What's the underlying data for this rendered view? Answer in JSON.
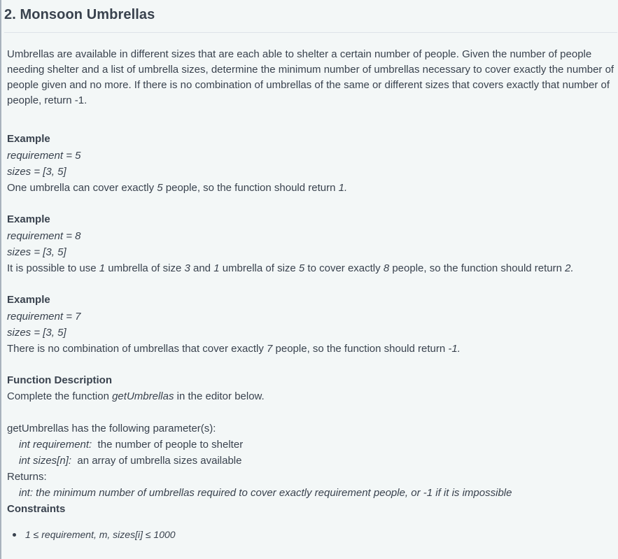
{
  "problem": {
    "title": "2. Monsoon Umbrellas",
    "intro": "Umbrellas are available in different sizes that are each able to shelter a certain number of people. Given the number of people needing shelter and a list of umbrella sizes, determine the minimum number of umbrellas necessary to cover exactly the number of people given and no more. If there is no combination of umbrellas of the same or different sizes that covers exactly that number of people, return -1."
  },
  "examples": [
    {
      "heading": "Example",
      "requirement": "requirement = 5",
      "sizes": "sizes = [3, 5]",
      "explanation": [
        {
          "t": "One umbrella can cover exactly ",
          "i": false
        },
        {
          "t": "5",
          "i": true
        },
        {
          "t": " people, so the function should return ",
          "i": false
        },
        {
          "t": "1.",
          "i": true
        }
      ]
    },
    {
      "heading": "Example",
      "requirement": "requirement = 8",
      "sizes": "sizes = [3, 5]",
      "explanation": [
        {
          "t": "It is possible to use ",
          "i": false
        },
        {
          "t": "1",
          "i": true
        },
        {
          "t": " umbrella of size ",
          "i": false
        },
        {
          "t": "3",
          "i": true
        },
        {
          "t": " and ",
          "i": false
        },
        {
          "t": "1",
          "i": true
        },
        {
          "t": " umbrella of size ",
          "i": false
        },
        {
          "t": "5",
          "i": true
        },
        {
          "t": " to cover exactly ",
          "i": false
        },
        {
          "t": "8",
          "i": true
        },
        {
          "t": " people, so the function should return ",
          "i": false
        },
        {
          "t": "2.",
          "i": true
        }
      ]
    },
    {
      "heading": "Example",
      "requirement": "requirement = 7",
      "sizes": "sizes = [3, 5]",
      "explanation": [
        {
          "t": "There is no combination of umbrellas that cover exactly ",
          "i": false
        },
        {
          "t": "7",
          "i": true
        },
        {
          "t": " people, so the function should return ",
          "i": false
        },
        {
          "t": "-1.",
          "i": true
        }
      ]
    }
  ],
  "function_description": {
    "heading": "Function Description",
    "text_before": "Complete the function ",
    "function_name": "getUmbrellas",
    "text_after": " in the editor below.",
    "params_intro": "getUmbrellas has the following parameter(s):",
    "params": [
      {
        "sig": "int requirement:",
        "desc": "  the number of people to shelter"
      },
      {
        "sig": "int sizes[n]:",
        "desc": "  an array of umbrella sizes available"
      }
    ],
    "returns_label": "Returns:",
    "returns": "int: the minimum number of umbrellas required to cover exactly requirement people, or -1 if it is impossible"
  },
  "constraints": {
    "heading": "Constraints",
    "items": [
      "1 ≤ requirement, m, sizes[i] ≤ 1000"
    ]
  }
}
